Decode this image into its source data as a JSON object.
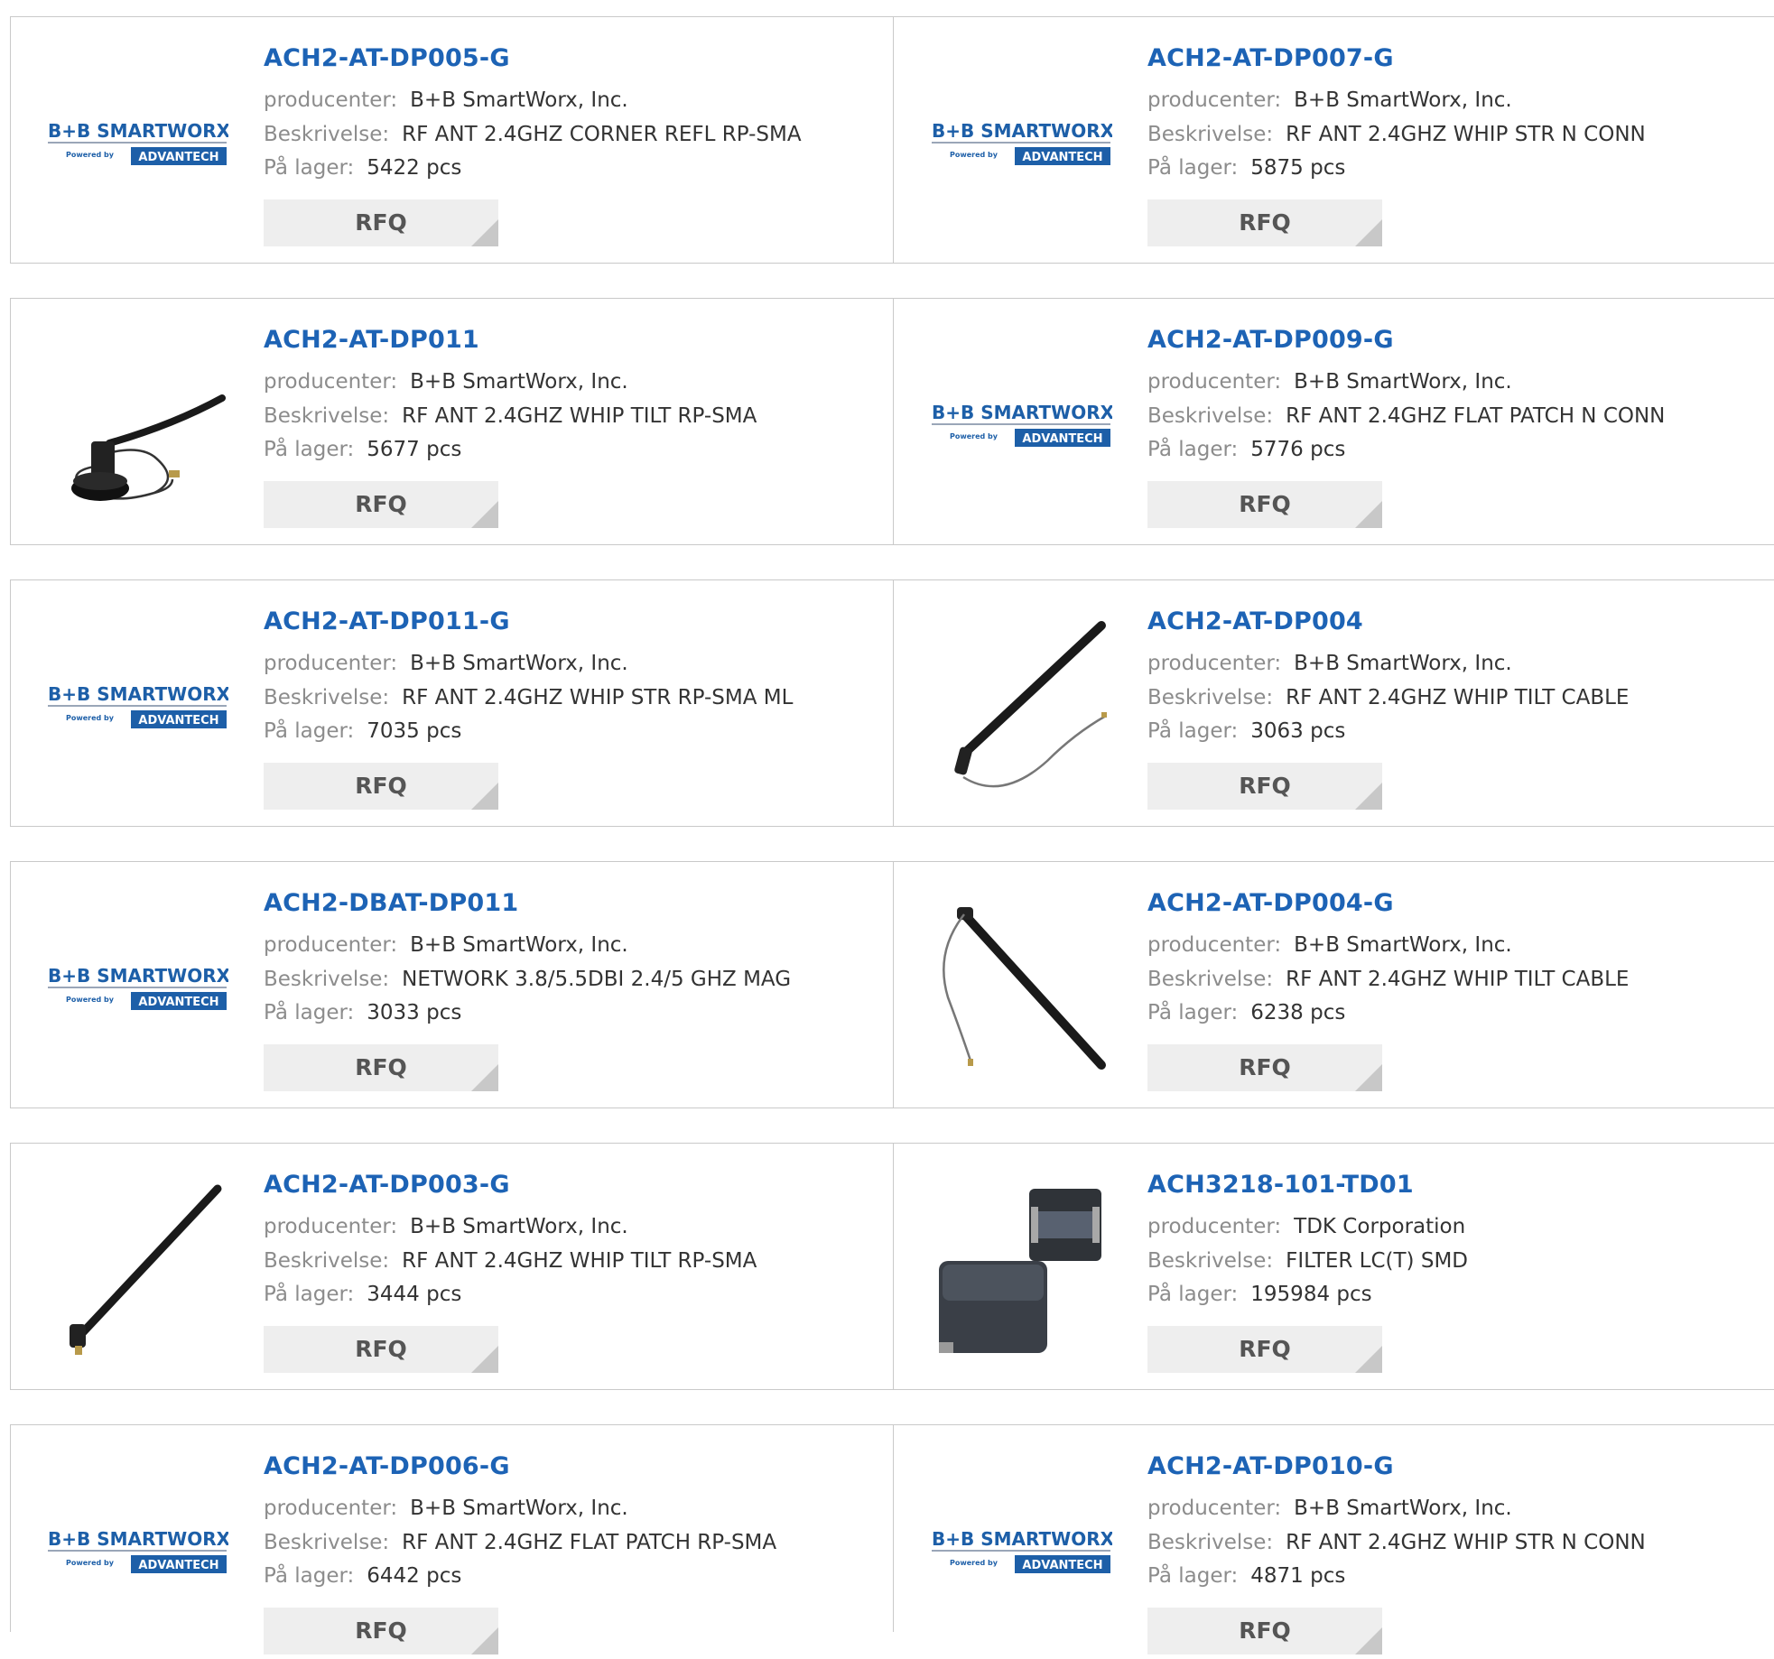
{
  "labels": {
    "manufacturer": "producenter:",
    "description": "Beskrivelse:",
    "stock": "På lager:",
    "rfq": "RFQ"
  },
  "logo": {
    "brand_text": "B+B SMARTWORX",
    "powered_text": "Powered by",
    "partner_text": "ADVANTECH",
    "brand_color": "#1d5fa8",
    "partner_bg": "#1d5fa8"
  },
  "colors": {
    "title": "#1d63b5",
    "label": "#8c8c8c",
    "value": "#333333",
    "button_bg": "#eeeeee",
    "border": "#c9c9c9"
  },
  "products": [
    {
      "part": "ACH2-AT-DP005-G",
      "manufacturer": "B+B SmartWorx, Inc.",
      "description": "RF ANT 2.4GHZ CORNER REFL RP-SMA",
      "stock": "5422 pcs",
      "image": "bb-smartworx-logo"
    },
    {
      "part": "ACH2-AT-DP007-G",
      "manufacturer": "B+B SmartWorx, Inc.",
      "description": "RF ANT 2.4GHZ WHIP STR N CONN",
      "stock": "5875 pcs",
      "image": "bb-smartworx-logo"
    },
    {
      "part": "ACH2-AT-DP011",
      "manufacturer": "B+B SmartWorx, Inc.",
      "description": "RF ANT 2.4GHZ WHIP TILT RP-SMA",
      "stock": "5677 pcs",
      "image": "magnetic-antenna-photo"
    },
    {
      "part": "ACH2-AT-DP009-G",
      "manufacturer": "B+B SmartWorx, Inc.",
      "description": "RF ANT 2.4GHZ FLAT PATCH N CONN",
      "stock": "5776 pcs",
      "image": "bb-smartworx-logo"
    },
    {
      "part": "ACH2-AT-DP011-G",
      "manufacturer": "B+B SmartWorx, Inc.",
      "description": "RF ANT 2.4GHZ WHIP STR RP-SMA ML",
      "stock": "7035 pcs",
      "image": "bb-smartworx-logo"
    },
    {
      "part": "ACH2-AT-DP004",
      "manufacturer": "B+B SmartWorx, Inc.",
      "description": "RF ANT 2.4GHZ WHIP TILT CABLE",
      "stock": "3063 pcs",
      "image": "cable-antenna-photo"
    },
    {
      "part": "ACH2-DBAT-DP011",
      "manufacturer": "B+B SmartWorx, Inc.",
      "description": "NETWORK 3.8/5.5DBI 2.4/5 GHZ MAG",
      "stock": "3033 pcs",
      "image": "bb-smartworx-logo"
    },
    {
      "part": "ACH2-AT-DP004-G",
      "manufacturer": "B+B SmartWorx, Inc.",
      "description": "RF ANT 2.4GHZ WHIP TILT CABLE",
      "stock": "6238 pcs",
      "image": "cable-antenna-photo-2"
    },
    {
      "part": "ACH2-AT-DP003-G",
      "manufacturer": "B+B SmartWorx, Inc.",
      "description": "RF ANT 2.4GHZ WHIP TILT RP-SMA",
      "stock": "3444 pcs",
      "image": "whip-antenna-photo"
    },
    {
      "part": "ACH3218-101-TD01",
      "manufacturer": "TDK Corporation",
      "description": "FILTER LC(T) SMD",
      "stock": "195984 pcs",
      "image": "smd-filter-photo"
    },
    {
      "part": "ACH2-AT-DP006-G",
      "manufacturer": "B+B SmartWorx, Inc.",
      "description": "RF ANT 2.4GHZ FLAT PATCH RP-SMA",
      "stock": "6442 pcs",
      "image": "bb-smartworx-logo"
    },
    {
      "part": "ACH2-AT-DP010-G",
      "manufacturer": "B+B SmartWorx, Inc.",
      "description": "RF ANT 2.4GHZ WHIP STR N CONN",
      "stock": "4871 pcs",
      "image": "bb-smartworx-logo"
    }
  ]
}
